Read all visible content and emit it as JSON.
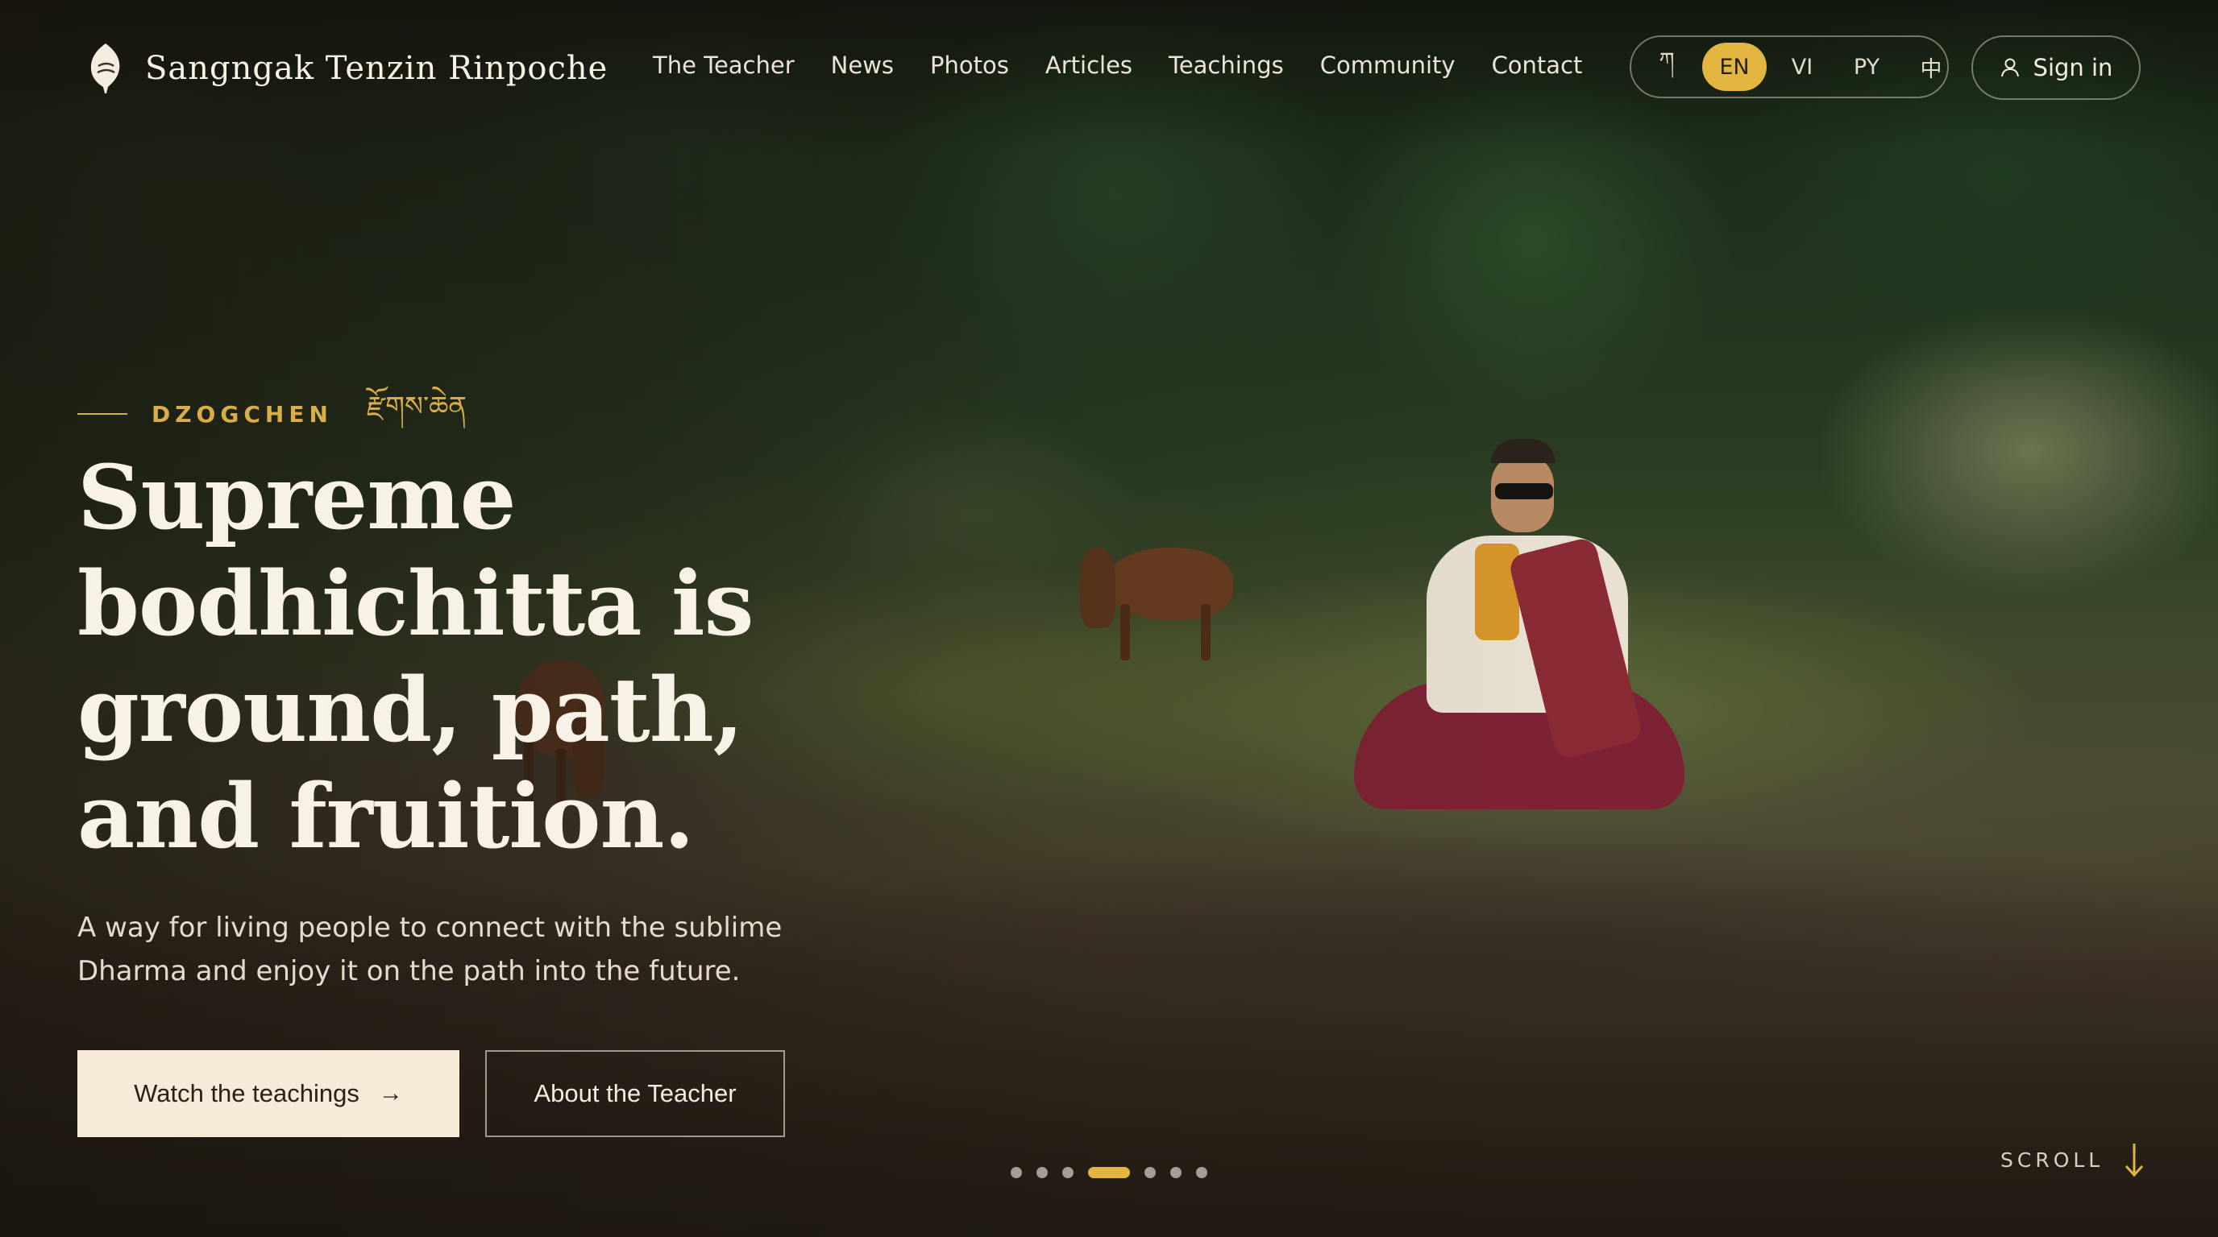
{
  "brand": {
    "name": "Sangngak Tenzin Rinpoche",
    "logo_icon": "conch-shell-icon"
  },
  "nav": {
    "items": [
      {
        "label": "The Teacher"
      },
      {
        "label": "News"
      },
      {
        "label": "Photos"
      },
      {
        "label": "Articles"
      },
      {
        "label": "Teachings"
      },
      {
        "label": "Community"
      },
      {
        "label": "Contact"
      }
    ]
  },
  "languages": {
    "options": [
      "ཀ",
      "EN",
      "VI",
      "PY",
      "中"
    ],
    "selected": "EN"
  },
  "signin": {
    "label": "Sign in",
    "icon": "user-icon"
  },
  "hero": {
    "eyebrow": "DZOGCHEN",
    "eyebrow_tibetan": "རྫོགས་ཆེན",
    "headline_lines": [
      "Supreme",
      "bodhichitta is",
      "ground, path,",
      "and fruition."
    ],
    "subtitle": "A way for living people to connect with the sublime Dharma and enjoy it on the path into the future.",
    "primary_cta": "Watch the teachings",
    "primary_cta_icon": "arrow-right-icon",
    "secondary_cta": "About the Teacher"
  },
  "carousel": {
    "slide_count": 7,
    "active_index": 3
  },
  "scroll": {
    "label": "SCROLL",
    "icon": "arrow-down-icon"
  },
  "colors": {
    "accent": "#e2b540",
    "gold_text": "#d9ae4a",
    "cream": "#f7ead8",
    "text_light": "#f4ecde"
  }
}
